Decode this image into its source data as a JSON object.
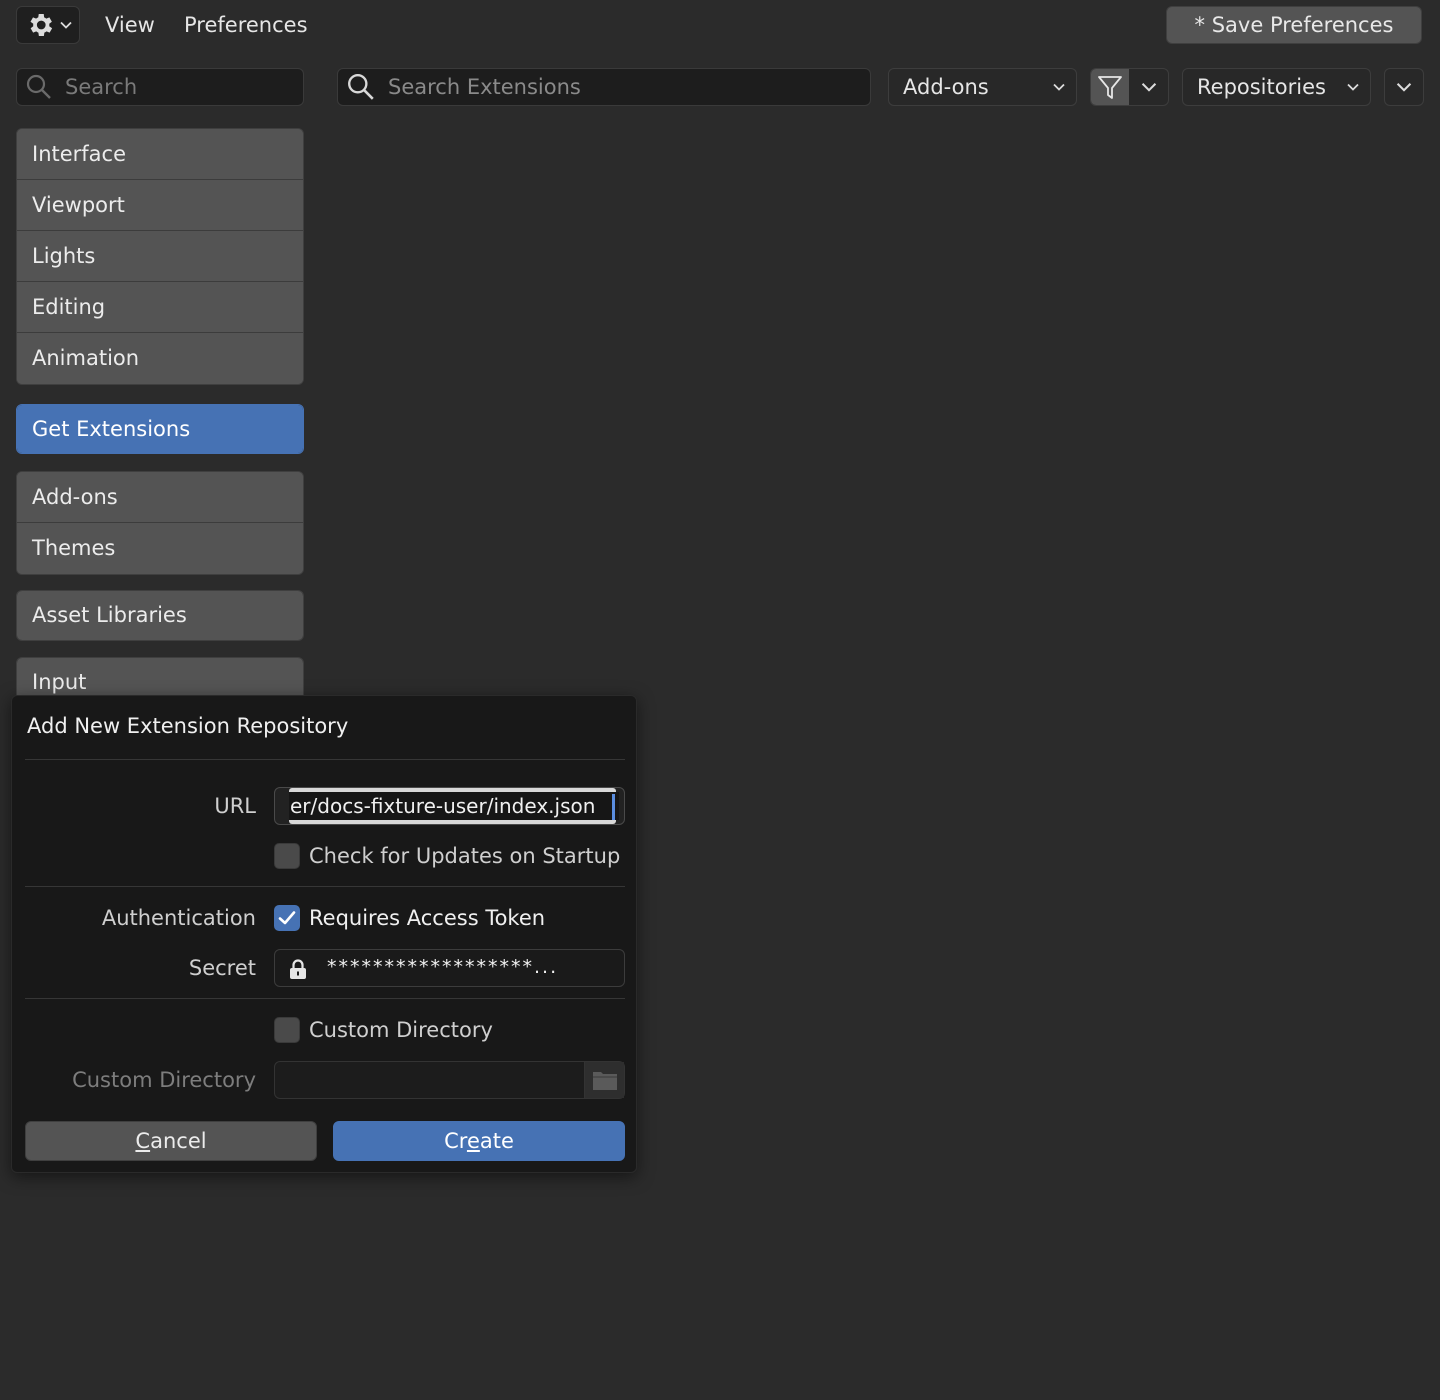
{
  "topbar": {
    "menu": [
      "View",
      "Preferences"
    ],
    "save_label": "* Save Preferences"
  },
  "search": {
    "placeholder": "Search"
  },
  "extensions_bar": {
    "search_placeholder": "Search Extensions",
    "type_dropdown": "Add-ons",
    "repos_dropdown": "Repositories"
  },
  "sidebar": {
    "groups": [
      [
        "Interface",
        "Viewport",
        "Lights",
        "Editing",
        "Animation"
      ],
      [
        "Get Extensions"
      ],
      [
        "Add-ons",
        "Themes"
      ],
      [
        "Asset Libraries"
      ],
      [
        "Input"
      ]
    ],
    "active": "Get Extensions"
  },
  "dialog": {
    "title": "Add New Extension Repository",
    "url_label": "URL",
    "url_value": "er/docs-fixture-user/index.json",
    "check_updates": {
      "label": "Check for Updates on Startup",
      "checked": false
    },
    "auth_label": "Authentication",
    "requires_token": {
      "label": "Requires Access Token",
      "checked": true
    },
    "secret_label": "Secret",
    "secret_value": "******************...",
    "custom_dir_toggle": {
      "label": "Custom Directory",
      "checked": false
    },
    "custom_dir_label": "Custom Directory",
    "custom_dir_value": "",
    "cancel_prefix": "",
    "cancel_u": "C",
    "cancel_rest": "ancel",
    "create_prefix": "Cr",
    "create_u": "e",
    "create_rest": "ate"
  },
  "icons": {
    "editor": "gear-icon",
    "search": "search-icon",
    "filter": "funnel-icon",
    "lock": "lock-icon",
    "folder": "folder-icon",
    "check": "checkmark-icon"
  },
  "colors": {
    "accent": "#4672b4",
    "background": "#2b2b2b",
    "dialog": "#181818"
  }
}
